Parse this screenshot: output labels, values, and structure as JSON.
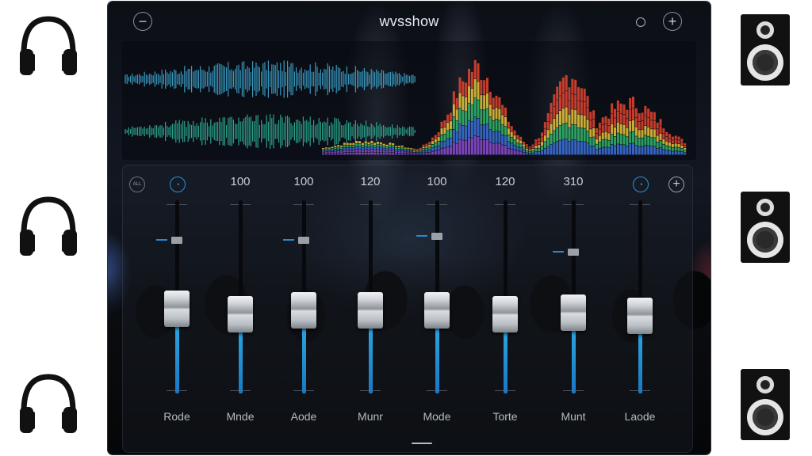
{
  "app": {
    "title": "wvsshow",
    "minus_icon": "minus-circle-icon",
    "plus_icon": "plus-circle-icon"
  },
  "visualizer": {
    "waveform_colors": [
      "#3fa9d4",
      "#2fb49a"
    ],
    "spectrum_colors": [
      "#8a4bd0",
      "#3a6fd8",
      "#31b56b",
      "#e3c33a",
      "#e0432f"
    ]
  },
  "mixer": {
    "accent": "#2aa6e6",
    "channels": [
      {
        "value": "",
        "label": "Rode",
        "level": 0.44,
        "mini": 0.81,
        "icon": "speaker-icon"
      },
      {
        "value": "100",
        "label": "Mnde",
        "level": 0.41
      },
      {
        "value": "100",
        "label": "Aode",
        "level": 0.43,
        "mini": 0.81
      },
      {
        "value": "120",
        "label": "Munr",
        "level": 0.43
      },
      {
        "value": "100",
        "label": "Mode",
        "level": 0.43,
        "mini": 0.83
      },
      {
        "value": "120",
        "label": "Torte",
        "level": 0.41
      },
      {
        "value": "310",
        "label": "Munt",
        "level": 0.42,
        "mini": 0.75
      },
      {
        "value": "",
        "label": "Laode",
        "level": 0.4,
        "icon": "speaker-icon"
      }
    ]
  }
}
